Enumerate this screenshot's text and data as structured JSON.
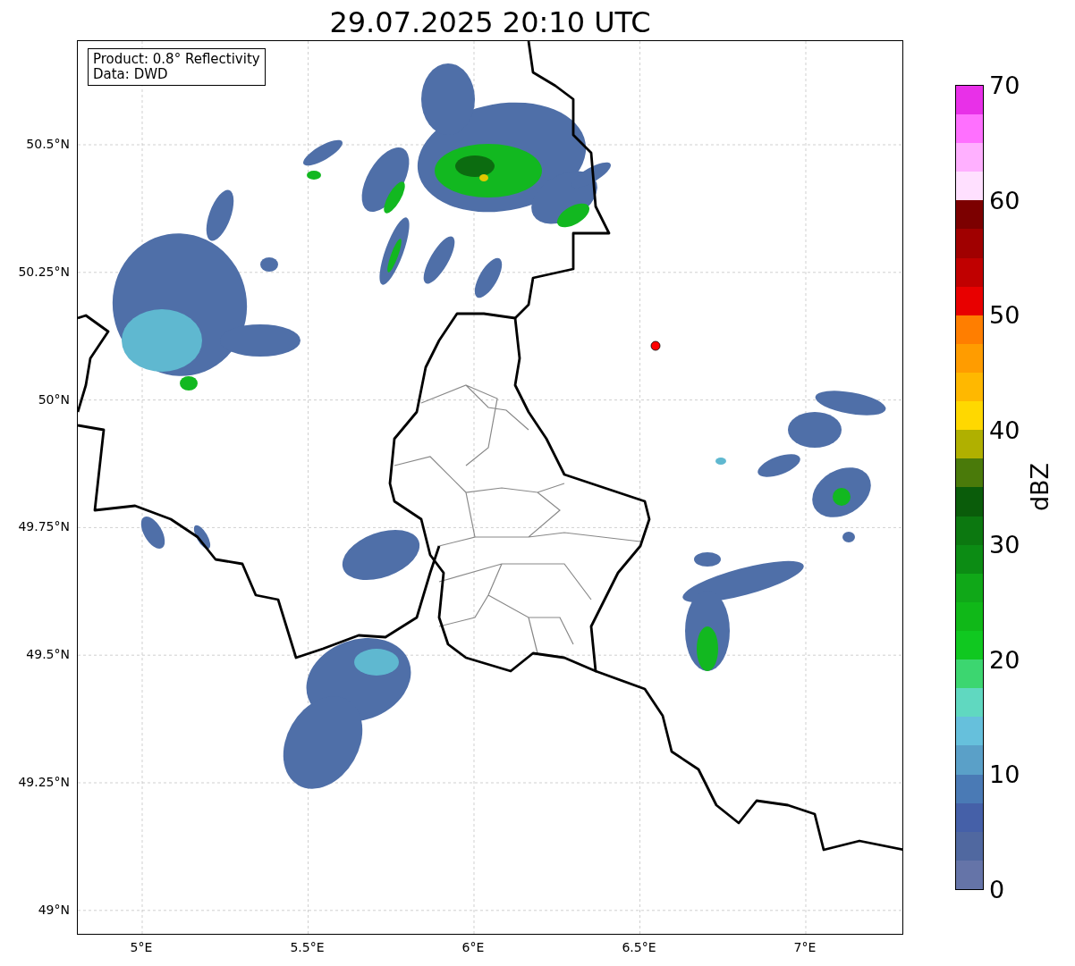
{
  "title": "29.07.2025 20:10 UTC",
  "legend": {
    "lines": [
      "Product: 0.8° Reflectivity",
      "Data: DWD"
    ]
  },
  "map": {
    "y_ticks": [
      "50.5°N",
      "50.25°N",
      "50°N",
      "49.75°N",
      "49.5°N",
      "49.25°N",
      "49°N"
    ],
    "x_ticks": [
      "5°E",
      "5.5°E",
      "6°E",
      "6.5°E",
      "7°E"
    ]
  },
  "colorbar": {
    "label": "dBZ",
    "ticks": [
      "70",
      "60",
      "50",
      "40",
      "30",
      "20",
      "10",
      "0"
    ],
    "bands": [
      {
        "color": "#6574a8"
      },
      {
        "color": "#5068a0"
      },
      {
        "color": "#4560a8"
      },
      {
        "color": "#4a7ab5"
      },
      {
        "color": "#5aa0c8"
      },
      {
        "color": "#66c0dc"
      },
      {
        "color": "#60d8c0"
      },
      {
        "color": "#3cd670"
      },
      {
        "color": "#10c820"
      },
      {
        "color": "#10b818"
      },
      {
        "color": "#10a818"
      },
      {
        "color": "#0c8c14"
      },
      {
        "color": "#0c7810"
      },
      {
        "color": "#0a5c0a"
      },
      {
        "color": "#4a7a0a"
      },
      {
        "color": "#b0b000"
      },
      {
        "color": "#ffd800"
      },
      {
        "color": "#ffb800"
      },
      {
        "color": "#ff9c00"
      },
      {
        "color": "#ff7e00"
      },
      {
        "color": "#e80000"
      },
      {
        "color": "#c00000"
      },
      {
        "color": "#a00000"
      },
      {
        "color": "#7c0000"
      },
      {
        "color": "#ffe0ff"
      },
      {
        "color": "#ffb0ff"
      },
      {
        "color": "#ff70ff"
      },
      {
        "color": "#e830e8"
      }
    ]
  }
}
